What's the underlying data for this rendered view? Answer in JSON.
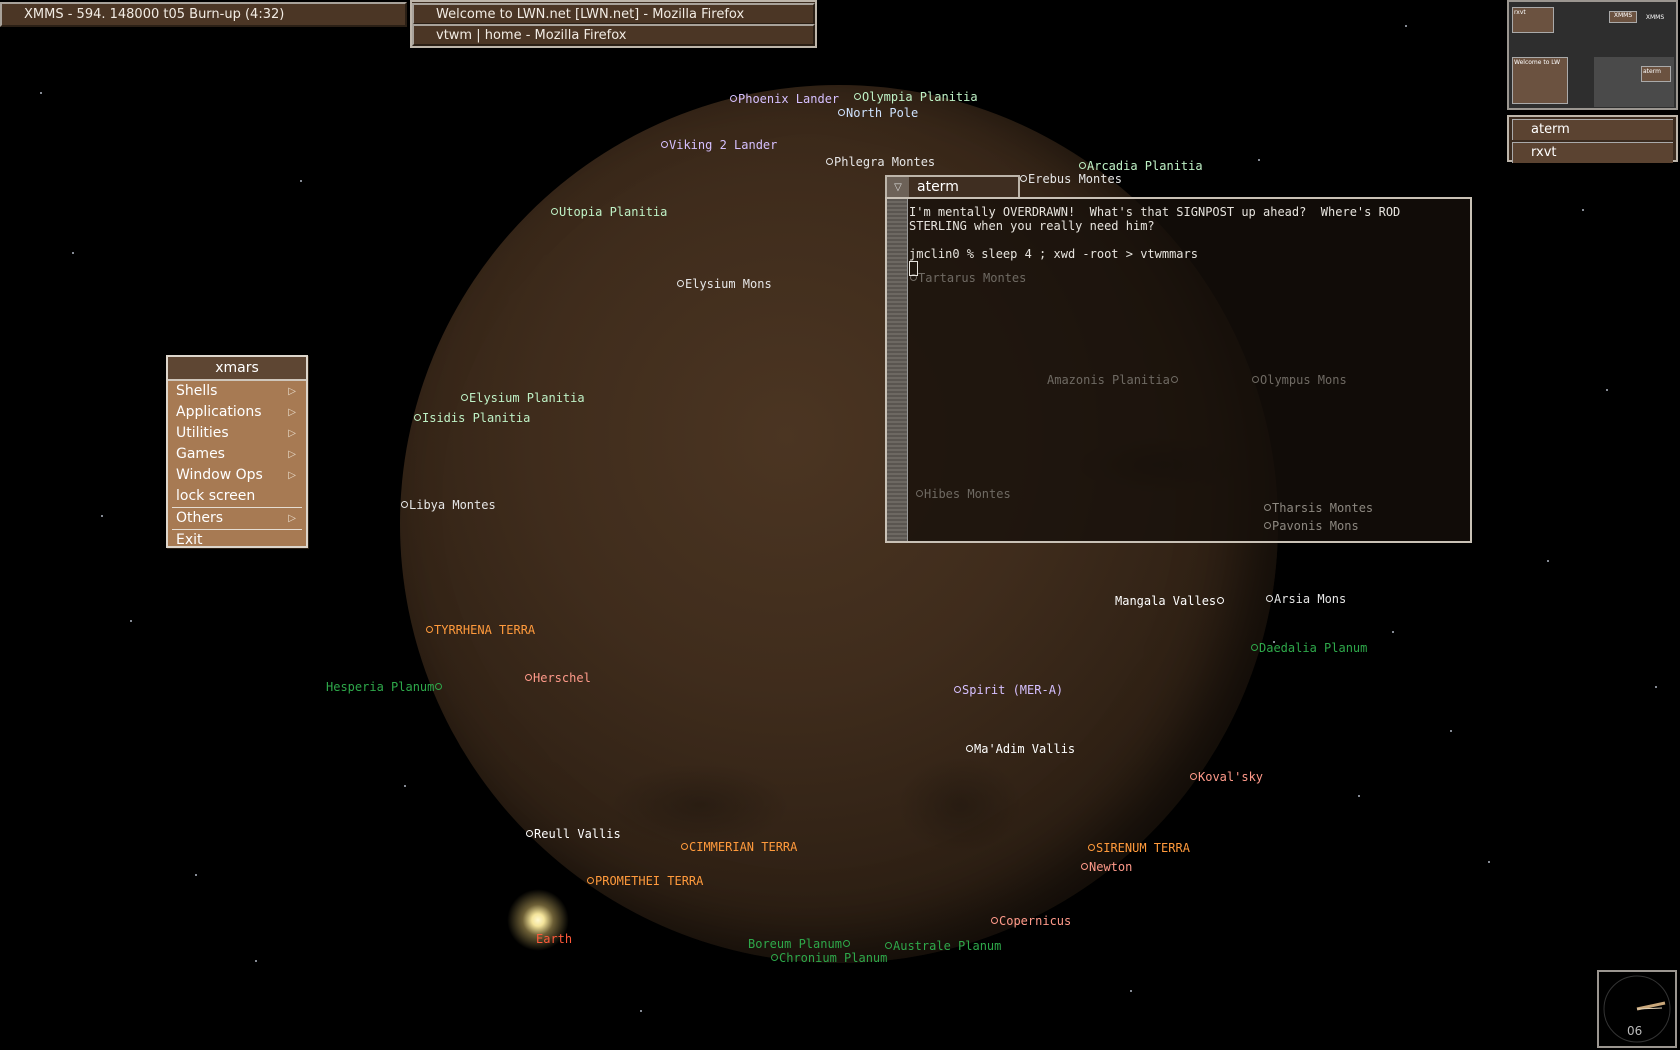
{
  "taskbar": {
    "xmms_title": "XMMS - 594. 148000 t05 Burn-up (4:32)",
    "firefox_title_1": "Welcome to LWN.net [LWN.net] - Mozilla Firefox",
    "firefox_title_2": "vtwm | home - Mozilla Firefox"
  },
  "pager": {
    "thumb_rxvt": "rxvt",
    "thumb_xmms": "XMMS",
    "thumb_xmms2": "XMMS",
    "thumb_lwn": "Welcome to LW",
    "thumb_aterm": "aterm"
  },
  "icon_manager": {
    "items": [
      "aterm",
      "rxvt"
    ]
  },
  "menu": {
    "title": "xmars",
    "items": [
      "Shells",
      "Applications",
      "Utilities",
      "Games",
      "Window Ops",
      "lock screen",
      "Others",
      "Exit"
    ]
  },
  "aterm": {
    "title": "aterm",
    "line1": "I'm mentally OVERDRAWN!  What's that SIGNPOST up ahead?  Where's ROD",
    "line2": "STERLING when you really need him?",
    "line3": "jmclin0 % sleep 4 ; xwd -root > vtwmmars"
  },
  "labels": [
    {
      "text": "Phoenix Lander",
      "color": "#d6c0ff"
    },
    {
      "text": "Olympia Planitia",
      "color": "#bff2c6"
    },
    {
      "text": "North Pole",
      "color": "#cfe3ff"
    },
    {
      "text": "Viking 2 Lander",
      "color": "#d6c0ff"
    },
    {
      "text": "Phlegra Montes",
      "color": "#e6e6e6"
    },
    {
      "text": "Arcadia Planitia",
      "color": "#bff2c6"
    },
    {
      "text": "Erebus Montes",
      "color": "#e6e6e6"
    },
    {
      "text": "Utopia Planitia",
      "color": "#bff2c6"
    },
    {
      "text": "Elysium Mons",
      "color": "#e6e6e6"
    },
    {
      "text": "Tartarus Montes",
      "color": "#6f6a63"
    },
    {
      "text": "Amazonis Planitia",
      "color": "#6f6a63"
    },
    {
      "text": "Olympus Mons",
      "color": "#6f6a63"
    },
    {
      "text": "Elysium Planitia",
      "color": "#bff2c6"
    },
    {
      "text": "Isidis Planitia",
      "color": "#bff2c6"
    },
    {
      "text": "Hibes Montes",
      "color": "#6f6a63"
    },
    {
      "text": "Tharsis Montes",
      "color": "#8d8880"
    },
    {
      "text": "Pavonis Mons",
      "color": "#8d8880"
    },
    {
      "text": "Libya Montes",
      "color": "#e6e6e6"
    },
    {
      "text": "Mangala Valles",
      "color": "#ffffff"
    },
    {
      "text": "Arsia Mons",
      "color": "#e6e6e6"
    },
    {
      "text": "TYRRHENA TERRA",
      "color": "#ff9a3c"
    },
    {
      "text": "Daedalia Planum",
      "color": "#2ea84a"
    },
    {
      "text": "Hesperia Planum",
      "color": "#2ea84a"
    },
    {
      "text": "Herschel",
      "color": "#ff9a8a"
    },
    {
      "text": "Spirit (MER-A)",
      "color": "#d6c0ff"
    },
    {
      "text": "Ma'Adim Vallis",
      "color": "#ffffff"
    },
    {
      "text": "Koval'sky",
      "color": "#ff9a8a"
    },
    {
      "text": "Reull Vallis",
      "color": "#ffffff"
    },
    {
      "text": "CIMMERIAN TERRA",
      "color": "#ff9a3c"
    },
    {
      "text": "SIRENUM TERRA",
      "color": "#ff9a3c"
    },
    {
      "text": "Newton",
      "color": "#ff9a8a"
    },
    {
      "text": "PROMETHEI TERRA",
      "color": "#ff9a3c"
    },
    {
      "text": "Copernicus",
      "color": "#ff9a8a"
    },
    {
      "text": "Earth",
      "color": "#ff5a3a"
    },
    {
      "text": "Boreum Planum",
      "color": "#2ea84a"
    },
    {
      "text": "Australe Planum",
      "color": "#2ea84a"
    },
    {
      "text": "Chronium Planum",
      "color": "#2ea84a"
    }
  ],
  "clock": {
    "label": "06"
  }
}
